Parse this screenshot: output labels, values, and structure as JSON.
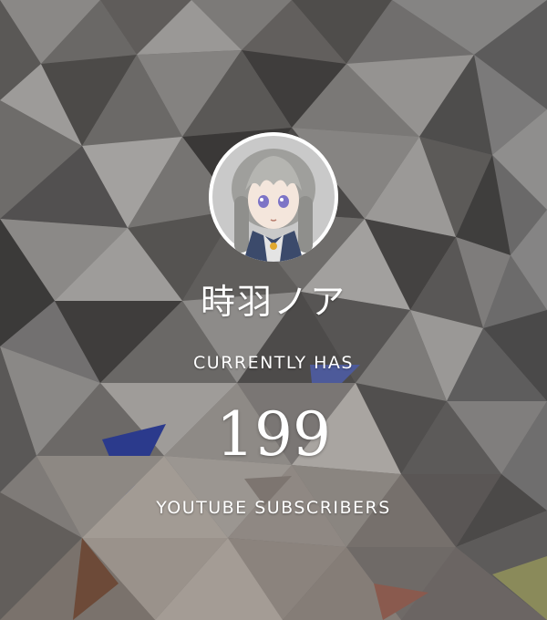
{
  "channel": {
    "name": "時羽ノア",
    "avatar_icon": "anime-character-avatar-icon"
  },
  "labels": {
    "top_caption": "CURRENTLY HAS",
    "bottom_caption": "YOUTUBE SUBSCRIBERS"
  },
  "stats": {
    "subscriber_count": "199"
  },
  "colors": {
    "text": "#ffffff",
    "accent_blue": "#2b3a8c",
    "background_gray": "#6f6c6a"
  }
}
